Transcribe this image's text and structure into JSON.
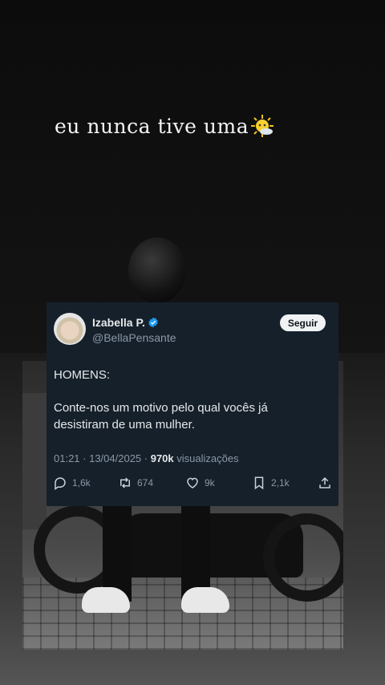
{
  "caption": {
    "text": "eu nunca tive uma",
    "emoji": "sun-behind-cloud-emoji"
  },
  "tweet": {
    "author_name": "Izabella P.",
    "handle": "@BellaPensante",
    "follow_label": "Seguir",
    "text_heading": "HOMENS:",
    "text_body": "Conte-nos um motivo pelo qual vocês já desistiram de uma mulher.",
    "time": "01:21 · 13/04/2025 ·",
    "views_count": "970k",
    "views_label": "visualizações",
    "replies": "1,6k",
    "retweets": "674",
    "likes": "9k",
    "bookmarks": "2,1k"
  },
  "colors": {
    "card_bg": "#15202b",
    "verified": "#1d9bf0",
    "muted_text": "#8b98a5"
  }
}
